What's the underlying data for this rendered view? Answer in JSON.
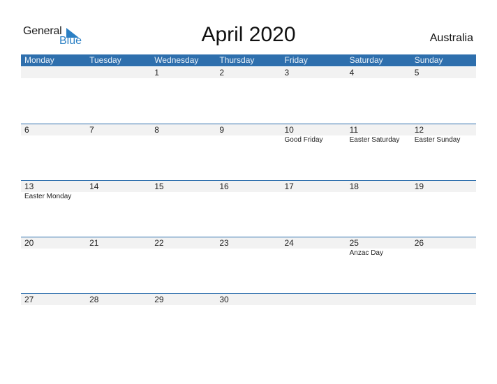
{
  "logo": {
    "word1": "General",
    "word2": "Blue",
    "accent": "#2a7fc4"
  },
  "title": "April 2020",
  "country": "Australia",
  "colors": {
    "header_bg": "#2e6fad",
    "date_strip_bg": "#f2f2f2"
  },
  "weekdays": [
    "Monday",
    "Tuesday",
    "Wednesday",
    "Thursday",
    "Friday",
    "Saturday",
    "Sunday"
  ],
  "weeks": [
    {
      "days": [
        "",
        "",
        "1",
        "2",
        "3",
        "4",
        "5"
      ],
      "events": [
        "",
        "",
        "",
        "",
        "",
        "",
        ""
      ]
    },
    {
      "days": [
        "6",
        "7",
        "8",
        "9",
        "10",
        "11",
        "12"
      ],
      "events": [
        "",
        "",
        "",
        "",
        "Good Friday",
        "Easter Saturday",
        "Easter Sunday"
      ]
    },
    {
      "days": [
        "13",
        "14",
        "15",
        "16",
        "17",
        "18",
        "19"
      ],
      "events": [
        "Easter Monday",
        "",
        "",
        "",
        "",
        "",
        ""
      ]
    },
    {
      "days": [
        "20",
        "21",
        "22",
        "23",
        "24",
        "25",
        "26"
      ],
      "events": [
        "",
        "",
        "",
        "",
        "",
        "Anzac Day",
        ""
      ]
    },
    {
      "days": [
        "27",
        "28",
        "29",
        "30",
        "",
        "",
        ""
      ],
      "events": [
        "",
        "",
        "",
        "",
        "",
        "",
        ""
      ]
    }
  ]
}
